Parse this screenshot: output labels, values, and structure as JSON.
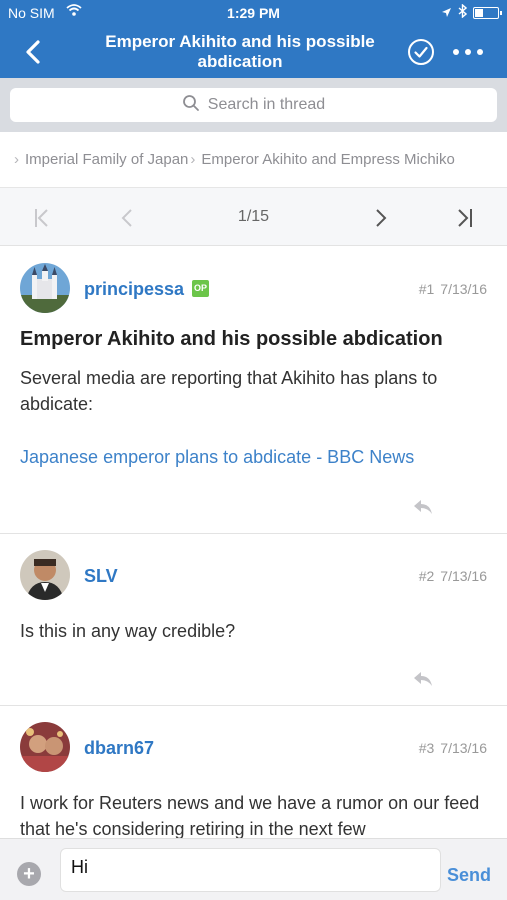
{
  "status_bar": {
    "carrier": "No SIM",
    "time": "1:29 PM"
  },
  "nav": {
    "title_line1": "Emperor Akihito and his possible",
    "title_line2": "abdication",
    "accent": "#2f78c4"
  },
  "search": {
    "placeholder": "Search in thread"
  },
  "breadcrumb": {
    "items": [
      "Imperial Family of Japan",
      "Emperor Akihito and Empress Michiko"
    ]
  },
  "pager": {
    "label": "1/15"
  },
  "posts": [
    {
      "user": "principessa",
      "badge": "OP",
      "number": "#1",
      "date": "7/13/16",
      "title": "Emperor Akihito and his possible abdication",
      "text": "Several media are reporting that Akihito has plans to abdicate:",
      "link": "Japanese emperor plans to abdicate - BBC News"
    },
    {
      "user": "SLV",
      "number": "#2",
      "date": "7/13/16",
      "text": "Is this in any way credible?"
    },
    {
      "user": "dbarn67",
      "number": "#3",
      "date": "7/13/16",
      "text": "I work for Reuters news and we have a rumor on our feed that he's considering retiring in the next few"
    }
  ],
  "composer": {
    "value": "Hi",
    "send_label": "Send"
  }
}
